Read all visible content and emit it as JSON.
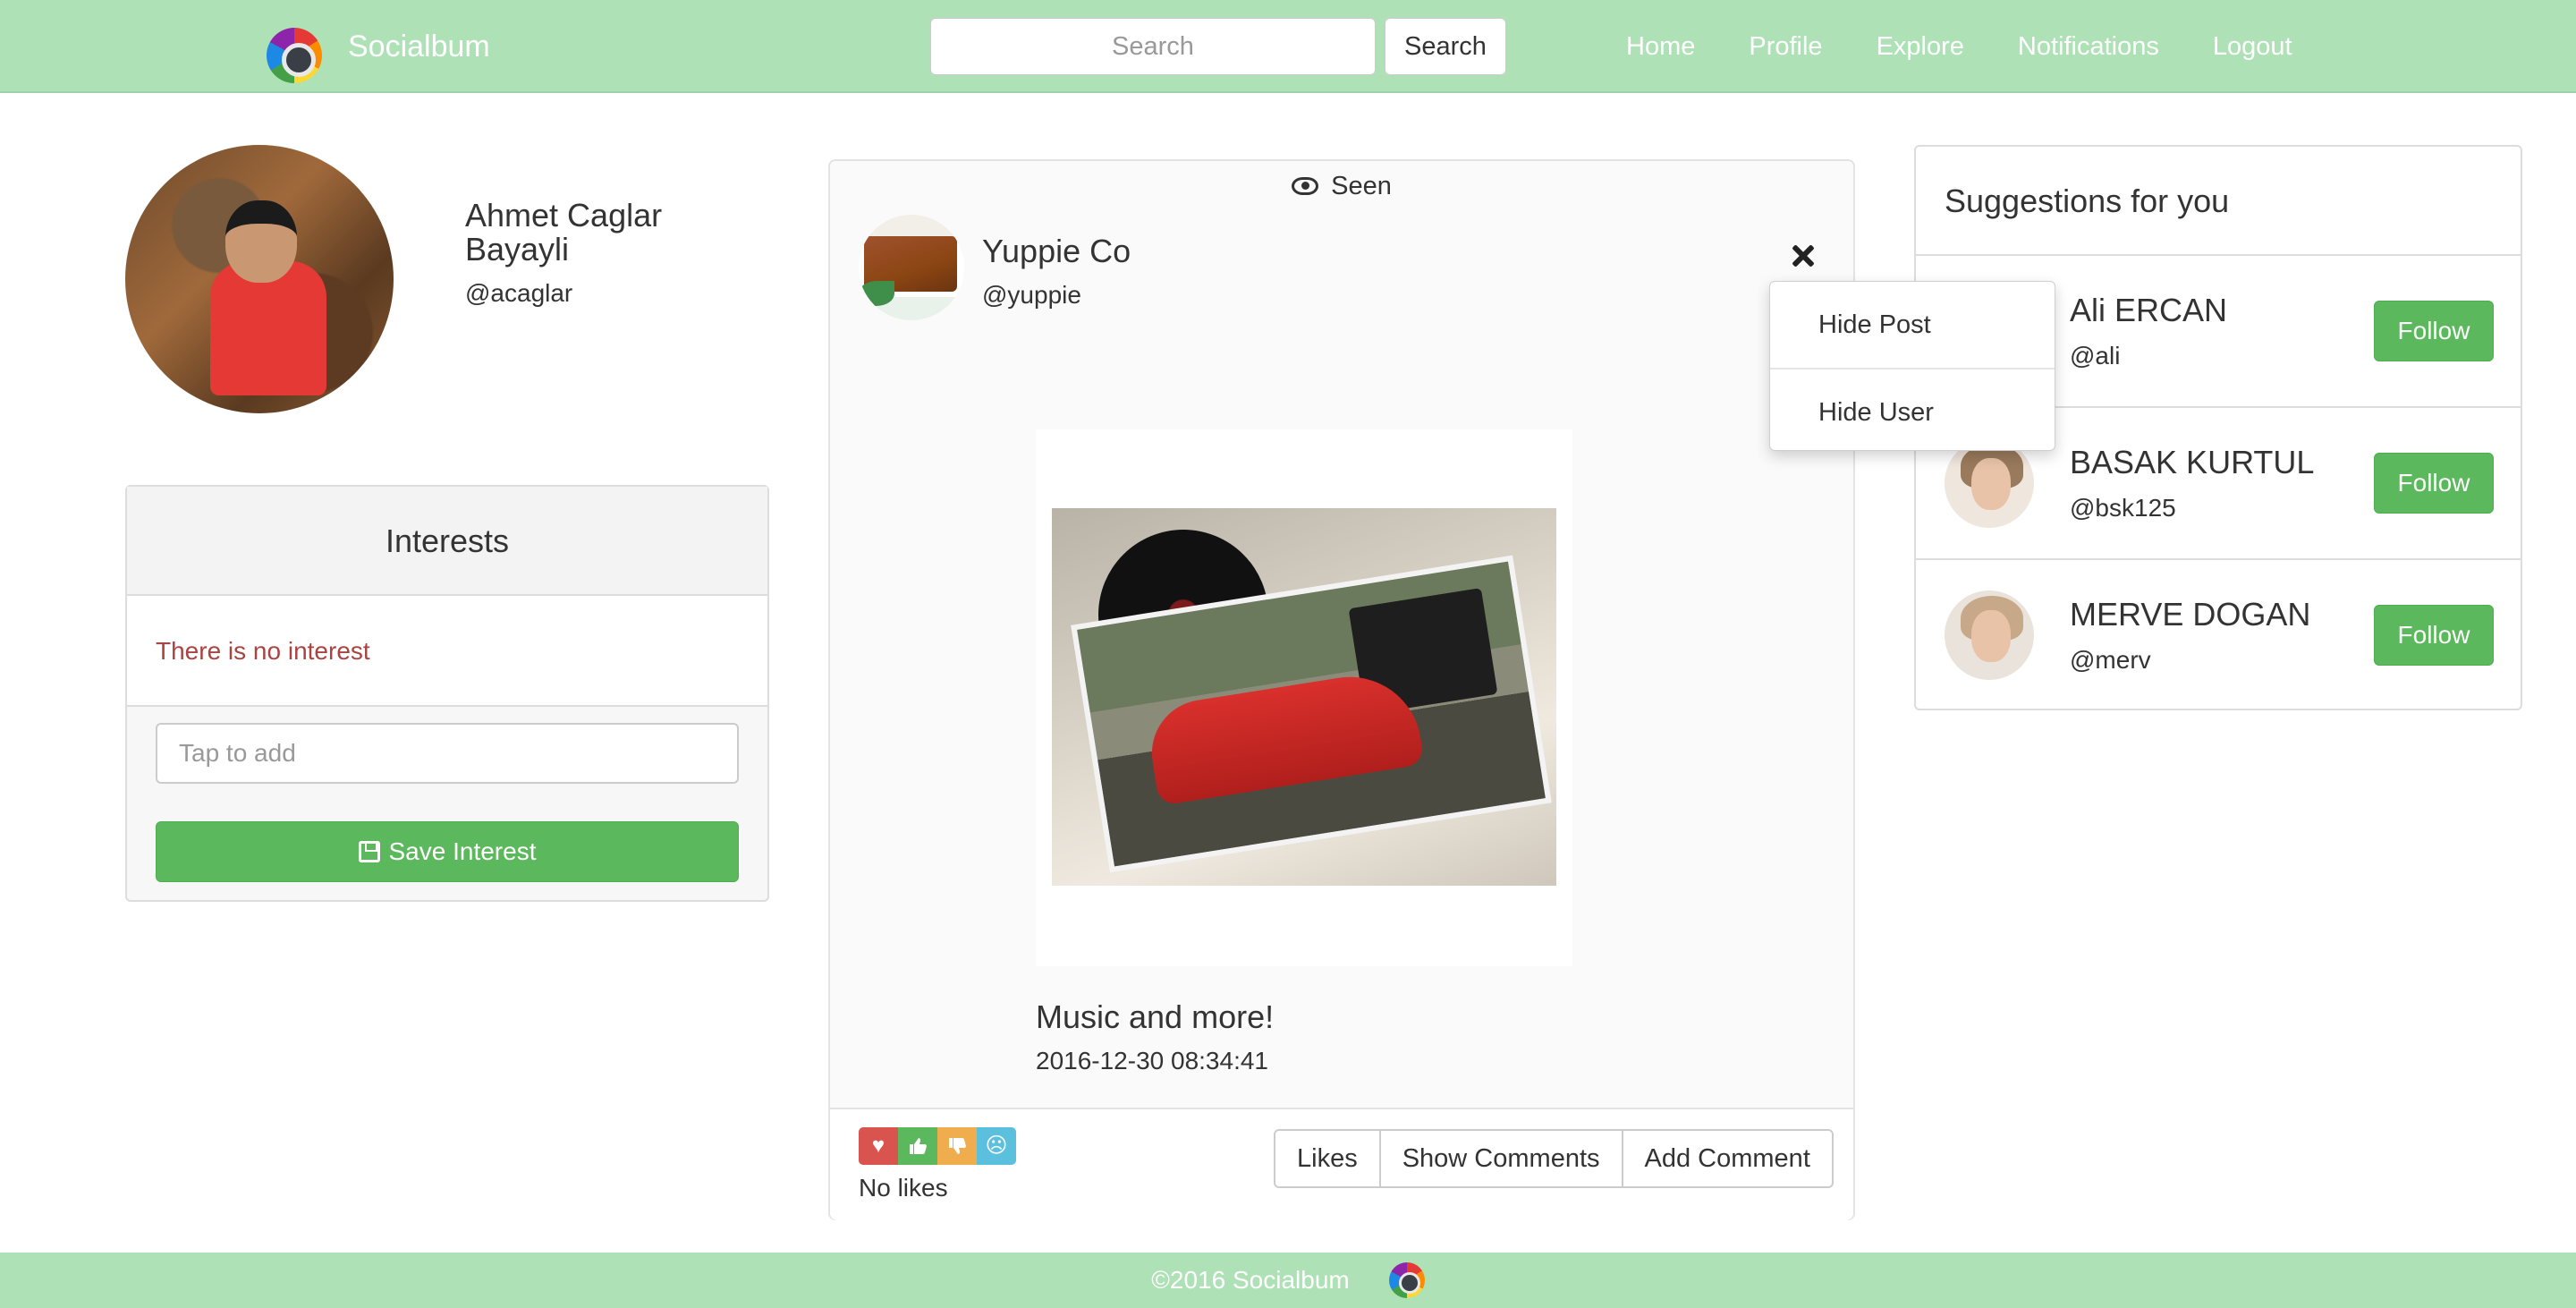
{
  "navbar": {
    "brand": "Socialbum",
    "search_placeholder": "Search",
    "search_button": "Search",
    "links": [
      "Home",
      "Profile",
      "Explore",
      "Notifications",
      "Logout"
    ],
    "background_color": "#aee2b6"
  },
  "profile": {
    "name": "Ahmet Caglar Bayayli",
    "handle": "@acaglar"
  },
  "interests": {
    "heading": "Interests",
    "empty_message": "There is no interest",
    "input_placeholder": "Tap to add",
    "save_label": "Save Interest",
    "save_icon": "floppy-disk-icon"
  },
  "post": {
    "seen_label": "Seen",
    "seen_icon": "eye-icon",
    "poster_name": "Yuppie Co",
    "poster_handle": "@yuppie",
    "menu": [
      "Hide Post",
      "Hide User"
    ],
    "title": "Music and more!",
    "date": "2016-12-30 08:34:41",
    "likes_text": "No likes",
    "reactions": [
      {
        "name": "heart-icon",
        "glyph": "♥",
        "color": "#d9534f"
      },
      {
        "name": "thumbs-up-icon",
        "glyph": "👍",
        "color": "#5cb85c"
      },
      {
        "name": "thumbs-down-icon",
        "glyph": "👎",
        "color": "#f0ad4e"
      },
      {
        "name": "sad-face-icon",
        "glyph": "☹",
        "color": "#5bc0de"
      }
    ],
    "actions": [
      "Likes",
      "Show Comments",
      "Add Comment"
    ]
  },
  "suggestions": {
    "heading": "Suggestions for you",
    "follow_label": "Follow",
    "users": [
      {
        "name": "Ali ERCAN",
        "handle": "@ali"
      },
      {
        "name": "BASAK KURTUL",
        "handle": "@bsk125"
      },
      {
        "name": "MERVE DOGAN",
        "handle": "@merv"
      }
    ]
  },
  "footer": {
    "text": "©2016 Socialbum"
  }
}
